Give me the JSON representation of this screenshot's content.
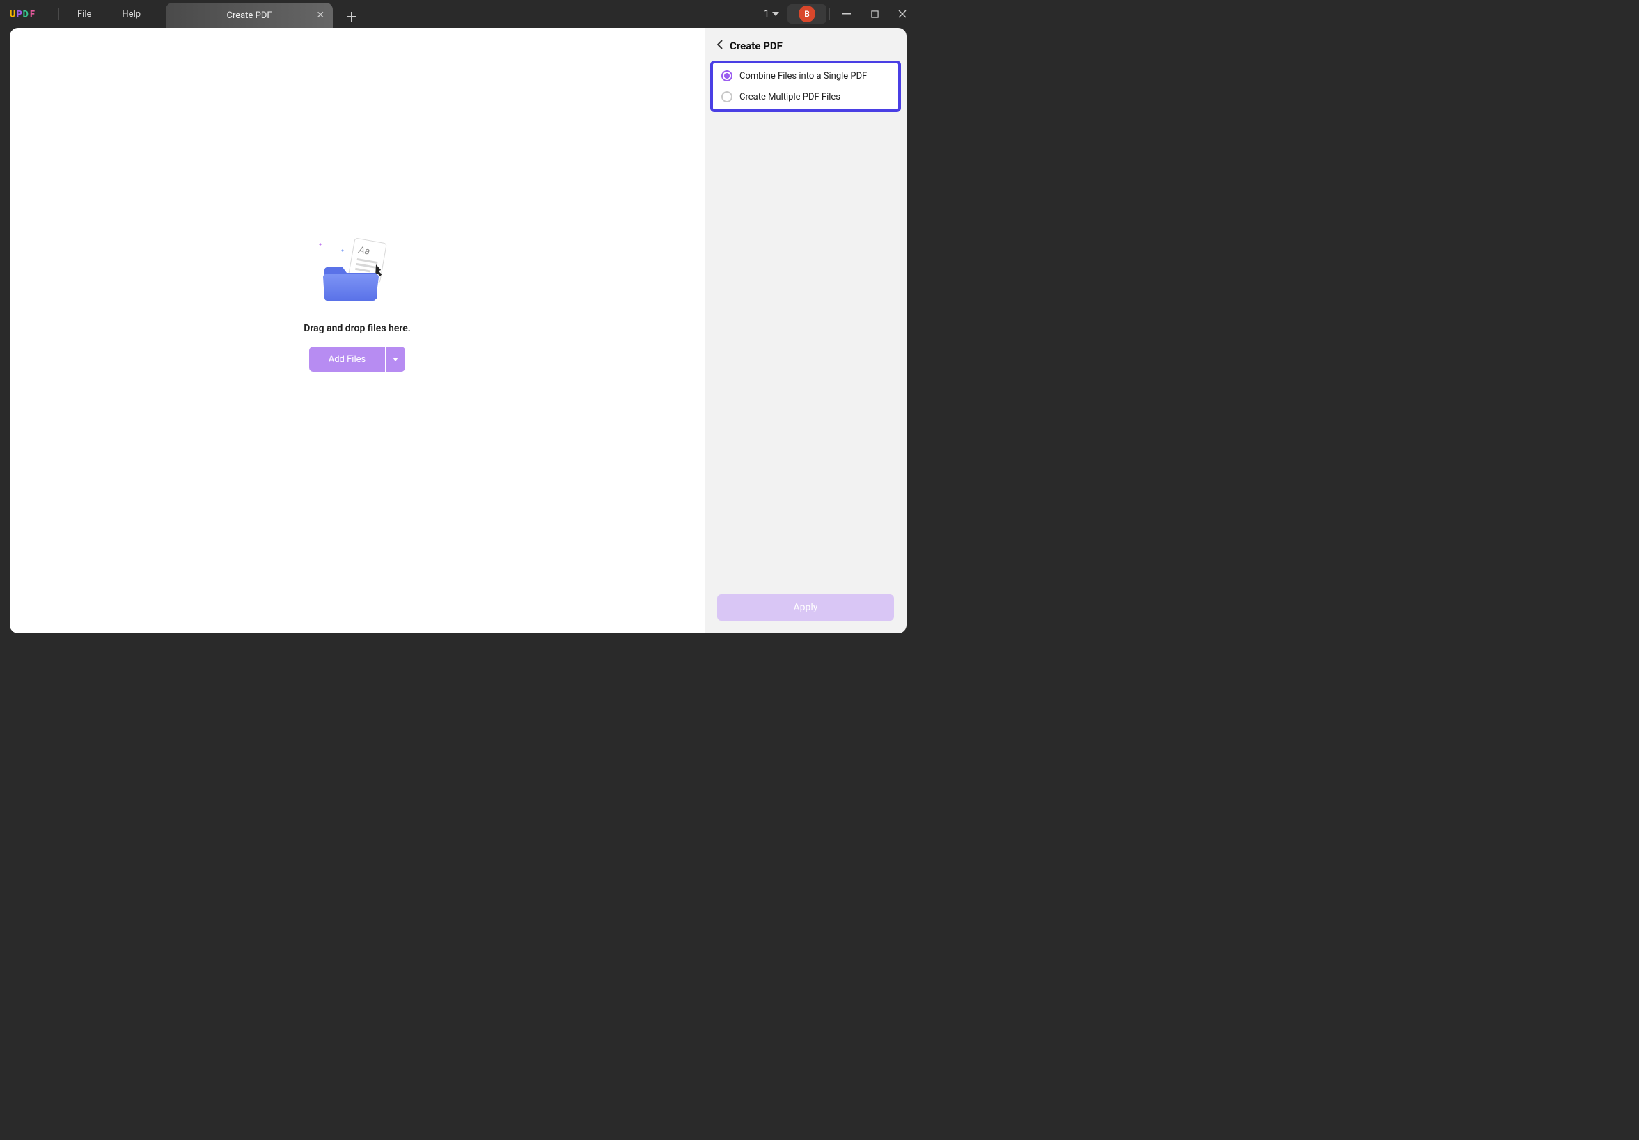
{
  "menu": {
    "file": "File",
    "help": "Help"
  },
  "tab": {
    "title": "Create PDF"
  },
  "titlebar": {
    "count": "1",
    "avatar_initial": "B"
  },
  "dropzone": {
    "text": "Drag and drop files here.",
    "add_files_label": "Add Files"
  },
  "sidebar": {
    "title": "Create PDF",
    "options": [
      {
        "label": "Combine Files into a Single PDF",
        "selected": true
      },
      {
        "label": "Create Multiple PDF Files",
        "selected": false
      }
    ],
    "apply_label": "Apply"
  }
}
